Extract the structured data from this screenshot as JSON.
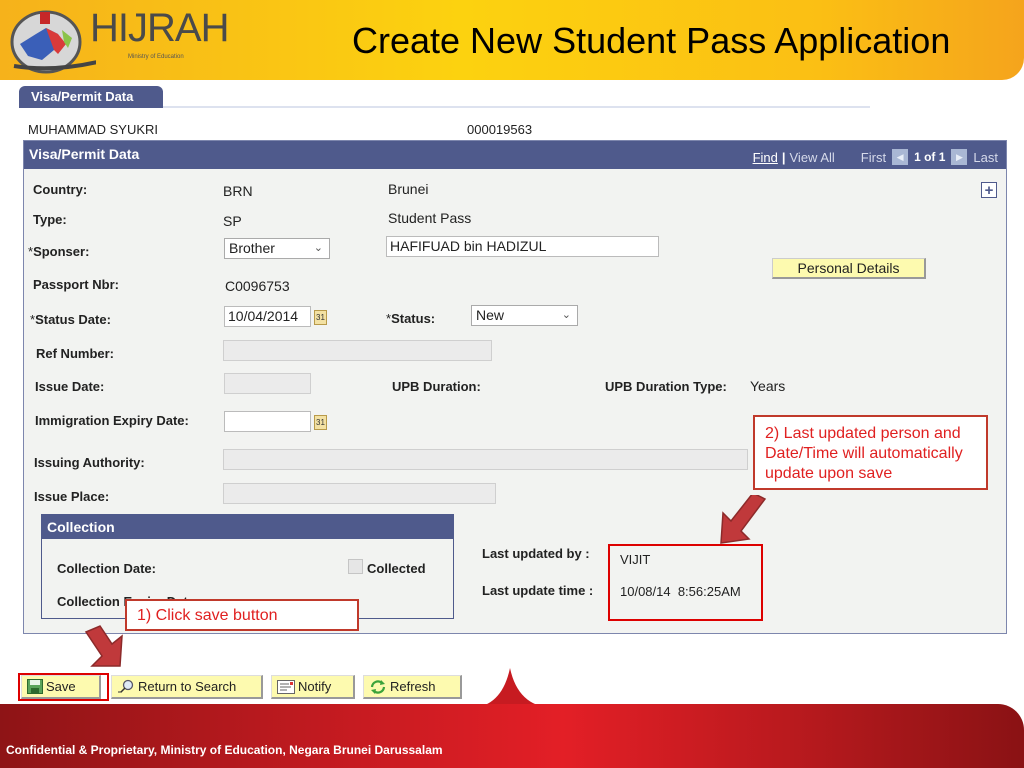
{
  "header": {
    "logo_text": "HIJRAH",
    "logo_tm": "™",
    "logo_subtitle": "Ministry of Education",
    "title": "Create New Student Pass Application"
  },
  "tab": {
    "label": "Visa/Permit Data"
  },
  "student": {
    "name": "MUHAMMAD SYUKRI",
    "id": "000019563"
  },
  "panel": {
    "title": "Visa/Permit Data",
    "nav": {
      "find": "Find",
      "separator": "|",
      "view_all": "View All",
      "first": "First",
      "count": "1 of 1",
      "last": "Last"
    },
    "add_icon": "+"
  },
  "fields": {
    "country_label": "Country:",
    "country_code": "BRN",
    "country_name": "Brunei",
    "type_label": "Type:",
    "type_code": "SP",
    "type_name": "Student Pass",
    "sponsor_label": "Sponser:",
    "sponsor_value": "Brother",
    "sponsor_name": "HAFIFUAD bin HADIZUL",
    "passport_label": "Passport Nbr:",
    "passport_value": "C0096753",
    "status_date_label": "Status Date:",
    "status_date_value": "10/04/2014",
    "status_label": "Status:",
    "status_value": "New",
    "ref_label": "Ref Number:",
    "ref_value": "",
    "issue_date_label": "Issue Date:",
    "issue_date_value": "",
    "upb_duration_label": "UPB Duration:",
    "upb_duration_type_label": "UPB Duration Type:",
    "upb_duration_type_value": "Years",
    "immigration_expiry_label": "Immigration Expiry Date:",
    "immigration_expiry_value": "",
    "issuing_authority_label": "Issuing Authority:",
    "issuing_authority_value": "",
    "issue_place_label": "Issue Place:",
    "issue_place_value": "",
    "required_mark": "*",
    "calendar_glyph": "31"
  },
  "personal_details_button": "Personal Details",
  "collection": {
    "title": "Collection",
    "collection_date_label": "Collection Date:",
    "collected_label": "Collected",
    "collected_checked": false,
    "collection_expiry_label": "Collection Expiry Date:"
  },
  "audit": {
    "last_updated_by_label": "Last updated by :",
    "last_updated_by_value": "VIJIT",
    "last_update_time_label": "Last update time :",
    "last_update_time_value": "10/08/14  8:56:25AM"
  },
  "annotations": {
    "note1": "1) Click save button",
    "note2": "2) Last updated person and Date/Time will automatically update upon save",
    "accent_color": "#c0392b"
  },
  "buttons": {
    "save": "Save",
    "return_to_search": "Return to Search",
    "notify": "Notify",
    "refresh": "Refresh"
  },
  "footer": {
    "text": "Confidential & Proprietary, Ministry of Education, Negara Brunei Darussalam"
  }
}
